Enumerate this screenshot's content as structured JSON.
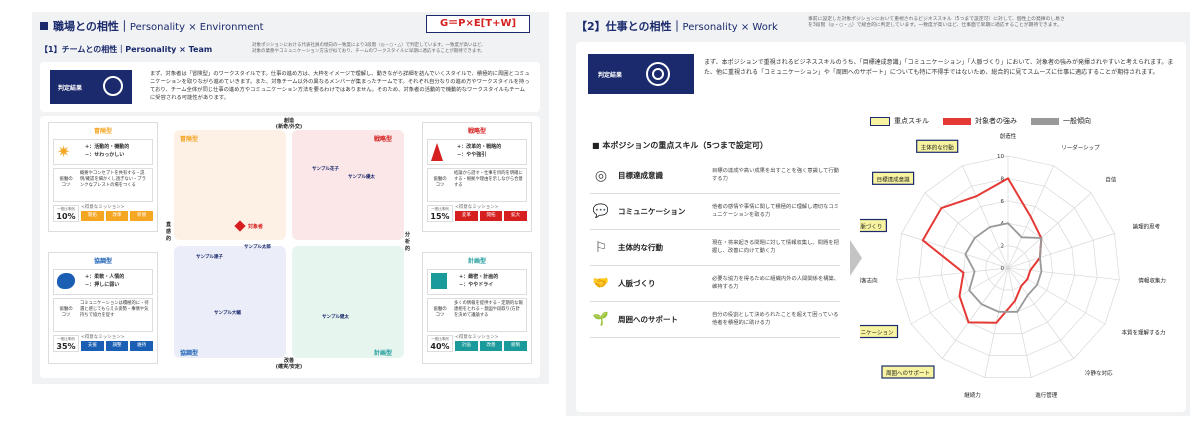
{
  "left": {
    "title": "職場との相性｜",
    "title_en": "Personality × Environment",
    "formula": "G＝P×E[T+W]",
    "team_title": "【1】チームとの相性｜Personality × Team",
    "team_desc": "対象ポジションにおける代表社員の傾向の一致度により3段階（◎・○・△）で判定しています。一致度が高いほど、",
    "team_desc2": "対象の業務やコミュニケーション方法が似ており、チームのワークスタイルに早期に適応することが期待できます。",
    "judge_label": "判定結果",
    "judge_mark": "○",
    "summary": "まず、対象者は「冒険型」のワークスタイルです。仕事の進め方は、大枠をイメージで理解し、動きながら詳細を詰んでいくスタイルで、積極的に周囲とコミュニケーションを取りながら進めていきます。また、対象チーム以外の異なるメンバーが集まったチームです。それぞれ自分なりの進め方やワークスタイルを持っており、チーム全体が同じ仕事の進め方やコミュニケーション方法を要るわけではありません。そのため、対象者の活動的で機動的なワークスタイルもチームに受容される可能性があります。",
    "axis_top": "創造",
    "axis_top2": "(新奇/外交)",
    "axis_bottom": "改善",
    "axis_bottom2": "(確実/安定)",
    "axis_left": "直感的",
    "axis_right": "分析的",
    "quadrants": {
      "tl": "冒険型",
      "tr": "戦略型",
      "bl": "協調型",
      "br": "計画型"
    },
    "samples": {
      "sample_tr1": "サンプル花子",
      "sample_tr2": "サンプル優太",
      "target": "対象者",
      "sample_mid": "サンプル太郎",
      "sample_bl1": "サンプル達子",
      "sample_bl2": "サンプル大輔",
      "sample_br": "サンプル健太"
    },
    "types": [
      {
        "name": "冒険型",
        "plus": "+：活動的・機動的",
        "minus": "−：せわっかしい",
        "tip": "概要やコンセプトを共有する・説明/確認を細かくし過ぎない・ブランクなブレストの場をつくる",
        "pct_label": "一般比率例",
        "pct": "10%",
        "mission_label": "<得意なミッション>",
        "missions": [
          "開拓",
          "改革",
          "新規"
        ],
        "color": "#f5a623"
      },
      {
        "name": "戦略型",
        "plus": "+：改革的・戦略的",
        "minus": "−：やや強引",
        "tip": "結論から話す・仕事を目的を明確にする・根拠や理由を示しながら合意する",
        "pct_label": "一般比率例",
        "pct": "15%",
        "mission_label": "<得意なミッション>",
        "missions": [
          "変革",
          "開拓",
          "拡大"
        ],
        "color": "#d62020"
      },
      {
        "name": "協調型",
        "plus": "+：柔軟・人情的",
        "minus": "−：押しに弱い",
        "tip": "コミュニケーションは積極的に・待遇と感じてもらえる姿勢・事情や気持ちで協力を促す",
        "pct_label": "一般比率例",
        "pct": "35%",
        "mission_label": "<得意なミッション>",
        "missions": [
          "支援",
          "調整",
          "維持"
        ],
        "color": "#1a5fb4"
      },
      {
        "name": "計画型",
        "plus": "+：緻密・計画的",
        "minus": "−：ややドライ",
        "tip": "多くの情報を提供する・定期的な報連相をとれる・意図や段取り/方針を決めて議論する",
        "pct_label": "一般比率例",
        "pct": "40%",
        "mission_label": "<得意なミッション>",
        "missions": [
          "計画",
          "改善",
          "統制"
        ],
        "color": "#1a9a9a"
      }
    ],
    "tip_label": "協働の",
    "tip_label2": "コツ"
  },
  "right": {
    "title": "【2】仕事との相性｜",
    "title_en": "Personality × Work",
    "desc": "事前に設定した対象ポジションにおいて重視されるビジネススキル（5つまで設定可）に対して、個性上の発揮のし易さ",
    "desc2": "を3段階（◎・○・△）で総合的に判定しています。一致度が高いほど、仕事面で早期に適応することが期待できます。",
    "judge_label": "判定結果",
    "judge_mark": "◎",
    "summary": "まず、本ポジションで重視されるビジネススキルのうち、「目標達成意識」「コミュニケーション」「人脈づくり」において、対象者の強みが発揮されやすいと考えられます。また、他に重視される「コミュニケーション」や「周囲へのサポート」についても特に不得手ではないため、総合的に見てスムーズに仕事に適応することが期待されます。",
    "skills_title": "■ 本ポジションの重点スキル（5つまで設定可）",
    "skills": [
      {
        "icon": "target-icon",
        "name": "目標達成意識",
        "desc": "目標の達成や高い成果を出すことを強く意識して行動する力"
      },
      {
        "icon": "chat-icon",
        "name": "コミュニケーション",
        "desc": "他者の感情や事情に関して積極的に理解し適切なコミュニケーションを取る力"
      },
      {
        "icon": "flag-icon",
        "name": "主体的な行動",
        "desc": "現在・将来起きる問題に対して情報収集し、問題を把握し、改善に向けて動く力"
      },
      {
        "icon": "handshake-icon",
        "name": "人脈づくり",
        "desc": "必要な協力を得るために組織内外の人間関係を構築、維持する力"
      },
      {
        "icon": "support-icon",
        "name": "周囲へのサポート",
        "desc": "自分の役割として決められたことを超えて困っている他者を積極的に助ける力"
      }
    ],
    "legend": [
      {
        "label": "重点スキル",
        "color": "#f7f3a0",
        "border": "#1a2a6c"
      },
      {
        "label": "対象者の強み",
        "color": "#e53935",
        "border": "#e53935"
      },
      {
        "label": "一般傾向",
        "color": "#999999",
        "border": "#999999"
      }
    ]
  },
  "chart_data": {
    "type": "radar",
    "axes": [
      "創造性",
      "リーダーシップ",
      "自信",
      "論理的思考",
      "情報収集力",
      "本質を理解する力",
      "冷静な対応",
      "進行管理",
      "継続力",
      "周囲へのサポート",
      "コミュニケーション",
      "顧客志向",
      "人脈づくり",
      "目標達成意識",
      "主体的な行動"
    ],
    "highlighted": [
      "主体的な行動",
      "目標達成意識",
      "人脈づくり",
      "コミュニケーション",
      "周囲へのサポート"
    ],
    "rmax": 10,
    "ticks": [
      0,
      2,
      4,
      6,
      8,
      10
    ],
    "series": [
      {
        "name": "対象者の強み",
        "color": "#e53935",
        "values": [
          8,
          5,
          4,
          3,
          2,
          2,
          2,
          3,
          5,
          6,
          5,
          4,
          8,
          8,
          7
        ]
      },
      {
        "name": "一般傾向",
        "color": "#999999",
        "values": [
          4,
          3,
          4,
          3,
          3,
          3,
          3,
          4,
          4,
          4,
          4,
          3,
          4,
          4,
          4
        ]
      }
    ]
  }
}
